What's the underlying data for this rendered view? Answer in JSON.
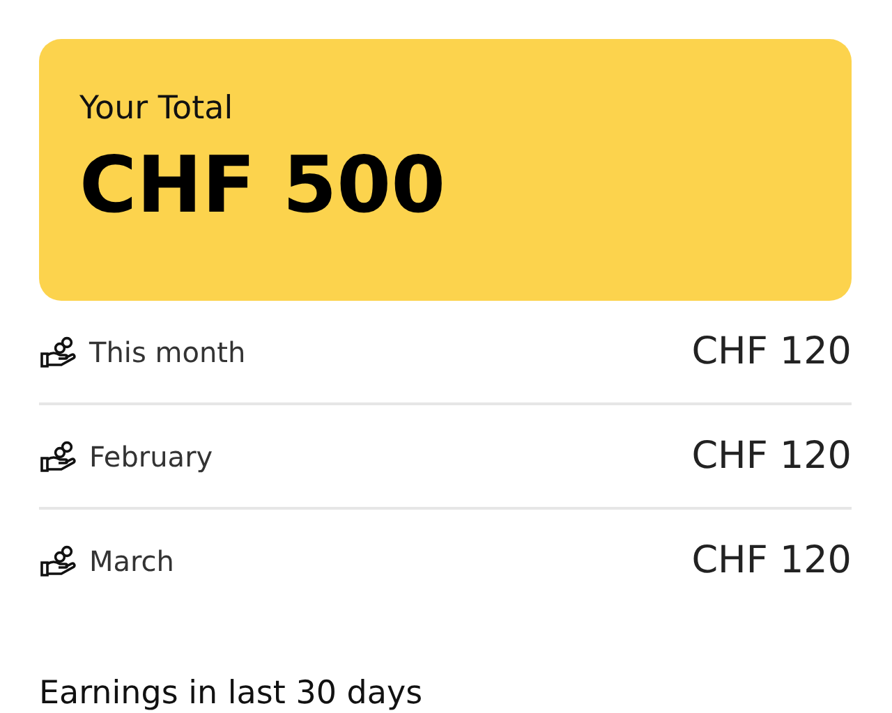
{
  "total": {
    "label": "Your Total",
    "amount": "CHF 500"
  },
  "rows": [
    {
      "label": "This month",
      "amount": "CHF 120"
    },
    {
      "label": "February",
      "amount": "CHF 120"
    },
    {
      "label": "March",
      "amount": "CHF 120"
    }
  ],
  "section_title": "Earnings in last 30 days"
}
